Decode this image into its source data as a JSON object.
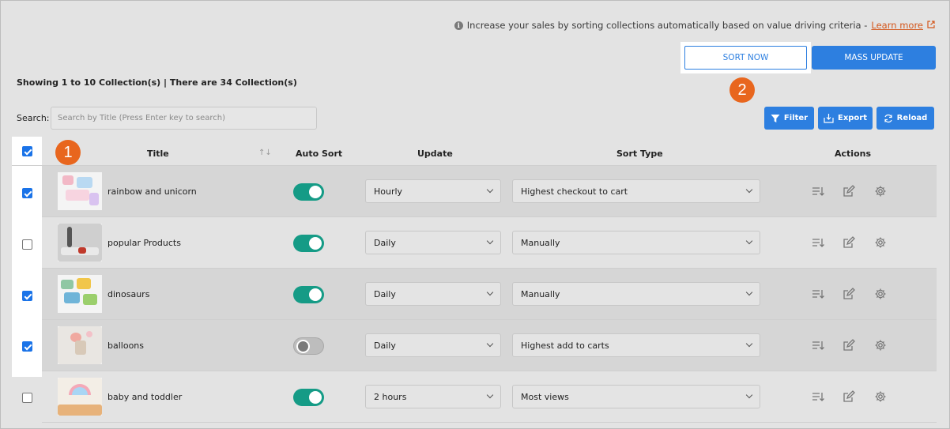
{
  "info": {
    "text": "Increase your sales by sorting collections automatically based on value driving criteria - ",
    "link": "Learn more"
  },
  "buttons": {
    "sort_now": "SORT NOW",
    "mass_update": "MASS UPDATE",
    "filter": "Filter",
    "export": "Export",
    "reload": "Reload"
  },
  "badges": {
    "one": "1",
    "two": "2"
  },
  "summary": "Showing 1 to 10 Collection(s) | There are 34 Collection(s)",
  "search": {
    "label": "Search:",
    "placeholder": "Search by Title (Press Enter key to search)"
  },
  "table": {
    "header_checked": true,
    "columns": {
      "title": "Title",
      "sort_arrows": "↑↓",
      "auto_sort": "Auto Sort",
      "update": "Update",
      "sort_type": "Sort Type",
      "actions": "Actions"
    },
    "rows": [
      {
        "title": "rainbow and unicorn",
        "checked": true,
        "auto_sort": true,
        "update": "Hourly",
        "sort_type": "Highest checkout to cart"
      },
      {
        "title": "popular Products",
        "checked": false,
        "auto_sort": true,
        "update": "Daily",
        "sort_type": "Manually"
      },
      {
        "title": "dinosaurs",
        "checked": true,
        "auto_sort": true,
        "update": "Daily",
        "sort_type": "Manually"
      },
      {
        "title": "balloons",
        "checked": true,
        "auto_sort": false,
        "update": "Daily",
        "sort_type": "Highest add to carts"
      },
      {
        "title": "baby and toddler",
        "checked": false,
        "auto_sort": true,
        "update": "2 hours",
        "sort_type": "Most views"
      }
    ]
  },
  "colors": {
    "primary": "#2d7fe0",
    "accent_orange": "#e8661e",
    "toggle_on": "#159b86",
    "background": "#e3e3e3"
  },
  "icons": [
    "info-icon",
    "external-link-icon",
    "filter-icon",
    "export-icon",
    "reload-icon",
    "sort-list-icon",
    "edit-icon",
    "gear-icon",
    "chevron-down-icon"
  ]
}
